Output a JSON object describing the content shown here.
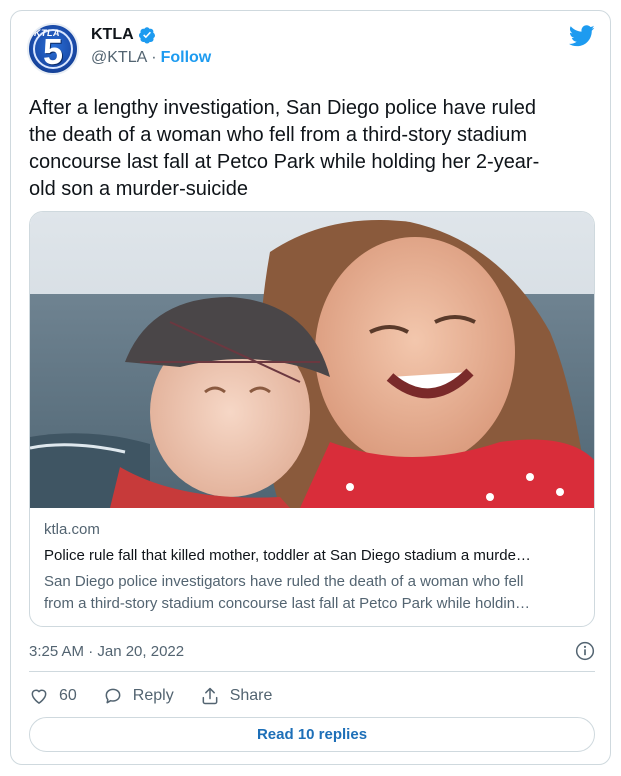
{
  "account": {
    "name": "KTLA",
    "handle": "@KTLA",
    "separator": "·",
    "follow_label": "Follow",
    "avatar_logo_text": "KTLA",
    "avatar_channel": "5"
  },
  "tweet": {
    "text": "After a lengthy investigation, San Diego police have ruled\nthe death of a woman who fell from a third-story stadium\nconcourse last fall at Petco Park while holding her 2-year-\nold son a murder-suicide",
    "timestamp": "3:25 AM · Jan 20, 2022"
  },
  "link_card": {
    "domain": "ktla.com",
    "title": "Police rule fall that killed mother, toddler at San Diego stadium a murde…",
    "description_line1": "San Diego police investigators have ruled the death of a woman who fell",
    "description_line2": "from a third-story stadium concourse last fall at Petco Park while holdin…"
  },
  "actions": {
    "like_count": "60",
    "reply_label": "Reply",
    "share_label": "Share"
  },
  "read_replies_label": "Read 10 replies",
  "icons": {
    "verified": "verified-badge-icon",
    "twitter": "twitter-bird-icon",
    "info": "info-icon",
    "like": "heart-icon",
    "reply": "speech-bubble-icon",
    "share": "share-upload-icon"
  },
  "colors": {
    "twitter_blue": "#1d9bf0",
    "replies_text": "#1d6fb8",
    "secondary_text": "#536471",
    "border": "#cfd9de"
  }
}
